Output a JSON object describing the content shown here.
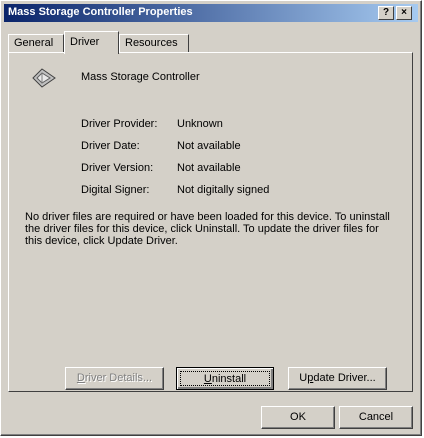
{
  "window": {
    "title": "Mass Storage Controller Properties",
    "help_glyph": "?",
    "close_glyph": "×"
  },
  "tabs": [
    {
      "label": "General",
      "active": false
    },
    {
      "label": "Driver",
      "active": true
    },
    {
      "label": "Resources",
      "active": false
    }
  ],
  "device": {
    "icon": "storage-controller-icon",
    "name": "Mass Storage Controller"
  },
  "driver_info": [
    {
      "label": "Driver Provider:",
      "value": "Unknown"
    },
    {
      "label": "Driver Date:",
      "value": "Not available"
    },
    {
      "label": "Driver Version:",
      "value": "Not available"
    },
    {
      "label": "Digital Signer:",
      "value": "Not digitally signed"
    }
  ],
  "description": "No driver files are required or have been loaded for this device. To uninstall the driver files for this device, click Uninstall. To update the driver files for this device, click Update Driver.",
  "buttons": {
    "driver_details": {
      "prefix": "",
      "accel": "D",
      "rest": "river Details...",
      "enabled": false
    },
    "uninstall": {
      "prefix": "",
      "accel": "U",
      "rest": "ninstall",
      "enabled": true
    },
    "update_driver": {
      "prefix": "U",
      "accel": "p",
      "rest": "date Driver...",
      "enabled": true
    },
    "ok": "OK",
    "cancel": "Cancel"
  },
  "colors": {
    "face": "#d4d0c8",
    "title_start": "#0a246a",
    "title_end": "#a6caf0"
  }
}
